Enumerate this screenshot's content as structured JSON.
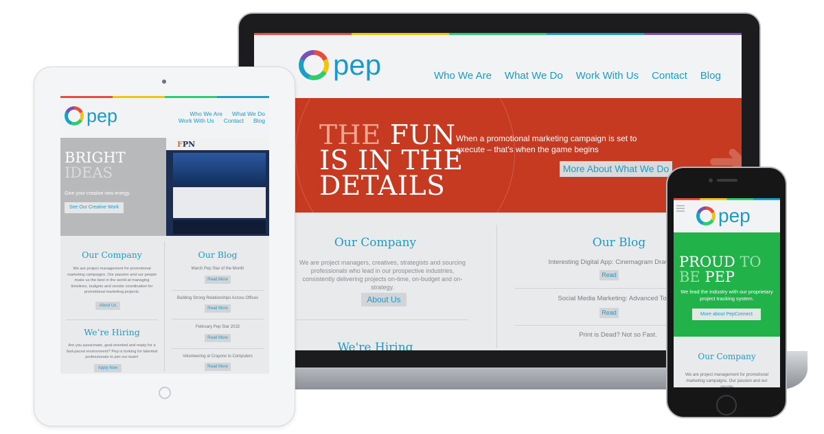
{
  "brand": {
    "name": "pep",
    "accent": "#1a9bc6",
    "red": "#c63a22",
    "green": "#21b24a"
  },
  "laptop": {
    "nav": [
      "Who We Are",
      "What We Do",
      "Work With Us",
      "Contact",
      "Blog"
    ],
    "hero": {
      "title_line1_dim": "THE",
      "title_line1": "FUN",
      "title_line2": "IS IN THE",
      "title_line3": "DETAILS",
      "text": "When a promotional marketing campaign is set to execute – that's when the game begins",
      "button": "More About What We Do"
    },
    "company": {
      "title": "Our Company",
      "text": "We are project managers, creatives, strategists and sourcing professionals who lead in our prospective industries, consistently delivering projects on-time, on-budget and on-strategy.",
      "button": "About Us"
    },
    "hiring_title": "We're Hiring",
    "blog": {
      "title": "Our Blog",
      "posts": [
        {
          "title": "Interesting Digital App: Cinemagram Draws Brands To",
          "button": "Read"
        },
        {
          "title": "Social Media Marketing: Advanced Topics",
          "button": "Read"
        },
        {
          "title": "Print is Dead? Not so Fast."
        }
      ]
    }
  },
  "tablet": {
    "nav_row1": [
      "Who We Are",
      "What We Do"
    ],
    "nav_row2": [
      "Work With Us",
      "Contact",
      "Blog"
    ],
    "hero": {
      "title_line1": "BRIGHT",
      "title_line2": "IDEAS",
      "text": "Give your creative new energy.",
      "button": "See Our Creative Work"
    },
    "fpn": {
      "logo_f": "F",
      "logo_rest": "PN"
    },
    "company": {
      "title": "Our Company",
      "text": "We are project management for promotional marketing campaigns. Our passion and our people make us the best in the world at managing timelines, budgets and vendor coordination for promotional marketing projects.",
      "button": "About Us"
    },
    "hiring": {
      "title": "We’re Hiring",
      "text": "Are you passionate, goal-oriented and ready for a fast-paced environment? Pep is looking for talented professionals to join our team!",
      "button": "Apply Now"
    },
    "blog": {
      "title": "Our Blog",
      "posts": [
        {
          "title": "March Pep Star of the Month",
          "button": "Read More"
        },
        {
          "title": "Building Strong Relationships Across Offices",
          "button": "Read More"
        },
        {
          "title": "February Pep Star 2015",
          "button": "Read More"
        },
        {
          "title": "Volunteering at Crayons to Computers",
          "button": "Read More"
        }
      ]
    }
  },
  "phone": {
    "hero": {
      "title_line1": "PROUD",
      "title_line1_dim": "TO",
      "title_line2_dim": "BE",
      "title_line2": "PEP",
      "text": "We lead the industry with our proprietary project tracking system.",
      "button": "More about PepConnect"
    },
    "company": {
      "title": "Our Company",
      "text": "We are project management for promotional marketing campaigns. Our passion and our people"
    }
  }
}
